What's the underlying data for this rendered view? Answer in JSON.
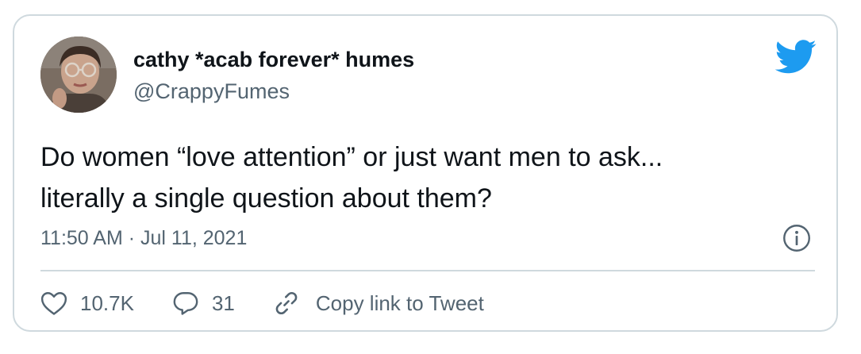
{
  "tweet": {
    "display_name": "cathy *acab forever* humes",
    "handle": "@CrappyFumes",
    "text_line1": "Do women “love attention” or just want men to ask...",
    "text_line2": "literally a single question about them?",
    "timestamp": "11:50 AM · Jul 11, 2021",
    "likes": "10.7K",
    "replies": "31",
    "share_label": "Copy link to Tweet"
  },
  "icons": {
    "brand": "twitter-bird-icon",
    "info": "info-icon",
    "like": "heart-icon",
    "reply": "reply-bubble-icon",
    "share": "link-icon"
  },
  "colors": {
    "brand": "#1d9bf0",
    "text": "#0f1419",
    "secondary": "#536471",
    "border": "#cfd9de"
  }
}
